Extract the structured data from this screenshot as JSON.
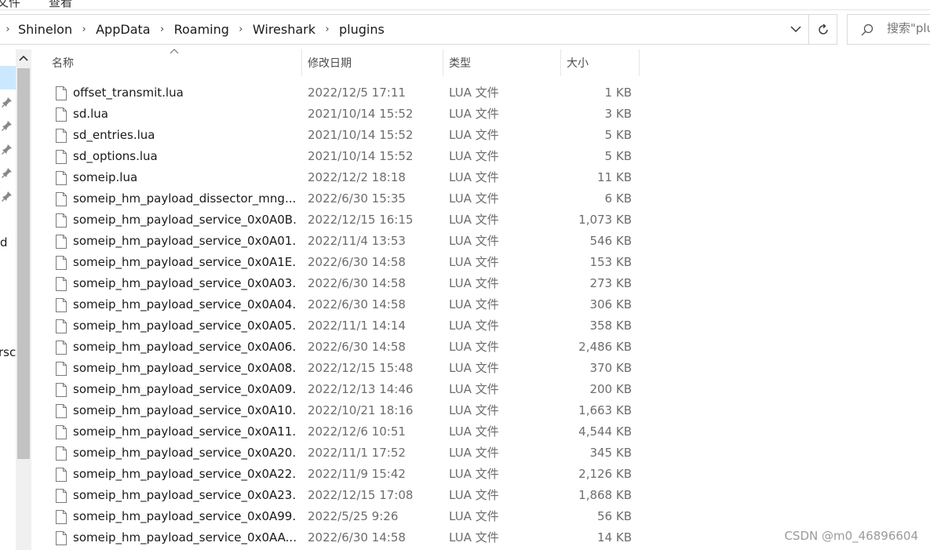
{
  "menu": {
    "items": [
      "文件",
      "查看"
    ]
  },
  "address": {
    "crumbs": [
      "Shinelon",
      "AppData",
      "Roaming",
      "Wireshark",
      "plugins"
    ]
  },
  "search": {
    "placeholder": "搜索\"plu"
  },
  "nav": {
    "texts": [
      "d",
      "rsc"
    ]
  },
  "columns": {
    "name": "名称",
    "date": "修改日期",
    "type": "类型",
    "size": "大小"
  },
  "files": [
    {
      "name": "offset_transmit.lua",
      "date": "2022/12/5 17:11",
      "type": "LUA 文件",
      "size": "1 KB"
    },
    {
      "name": "sd.lua",
      "date": "2021/10/14 15:52",
      "type": "LUA 文件",
      "size": "3 KB"
    },
    {
      "name": "sd_entries.lua",
      "date": "2021/10/14 15:52",
      "type": "LUA 文件",
      "size": "5 KB"
    },
    {
      "name": "sd_options.lua",
      "date": "2021/10/14 15:52",
      "type": "LUA 文件",
      "size": "5 KB"
    },
    {
      "name": "someip.lua",
      "date": "2022/12/2 18:18",
      "type": "LUA 文件",
      "size": "11 KB"
    },
    {
      "name": "someip_hm_payload_dissector_mng....",
      "date": "2022/6/30 15:35",
      "type": "LUA 文件",
      "size": "6 KB"
    },
    {
      "name": "someip_hm_payload_service_0x0A0B...",
      "date": "2022/12/15 16:15",
      "type": "LUA 文件",
      "size": "1,073 KB"
    },
    {
      "name": "someip_hm_payload_service_0x0A01...",
      "date": "2022/11/4 13:53",
      "type": "LUA 文件",
      "size": "546 KB"
    },
    {
      "name": "someip_hm_payload_service_0x0A1E...",
      "date": "2022/6/30 14:58",
      "type": "LUA 文件",
      "size": "153 KB"
    },
    {
      "name": "someip_hm_payload_service_0x0A03...",
      "date": "2022/6/30 14:58",
      "type": "LUA 文件",
      "size": "273 KB"
    },
    {
      "name": "someip_hm_payload_service_0x0A04...",
      "date": "2022/6/30 14:58",
      "type": "LUA 文件",
      "size": "306 KB"
    },
    {
      "name": "someip_hm_payload_service_0x0A05...",
      "date": "2022/11/1 14:14",
      "type": "LUA 文件",
      "size": "358 KB"
    },
    {
      "name": "someip_hm_payload_service_0x0A06...",
      "date": "2022/6/30 14:58",
      "type": "LUA 文件",
      "size": "2,486 KB"
    },
    {
      "name": "someip_hm_payload_service_0x0A08...",
      "date": "2022/12/15 15:48",
      "type": "LUA 文件",
      "size": "370 KB"
    },
    {
      "name": "someip_hm_payload_service_0x0A09...",
      "date": "2022/12/13 14:46",
      "type": "LUA 文件",
      "size": "200 KB"
    },
    {
      "name": "someip_hm_payload_service_0x0A10...",
      "date": "2022/10/21 18:16",
      "type": "LUA 文件",
      "size": "1,663 KB"
    },
    {
      "name": "someip_hm_payload_service_0x0A11...",
      "date": "2022/12/6 10:51",
      "type": "LUA 文件",
      "size": "4,544 KB"
    },
    {
      "name": "someip_hm_payload_service_0x0A20...",
      "date": "2022/11/1 17:52",
      "type": "LUA 文件",
      "size": "345 KB"
    },
    {
      "name": "someip_hm_payload_service_0x0A22...",
      "date": "2022/11/9 15:42",
      "type": "LUA 文件",
      "size": "2,126 KB"
    },
    {
      "name": "someip_hm_payload_service_0x0A23...",
      "date": "2022/12/15 17:08",
      "type": "LUA 文件",
      "size": "1,868 KB"
    },
    {
      "name": "someip_hm_payload_service_0x0A99...",
      "date": "2022/5/25 9:26",
      "type": "LUA 文件",
      "size": "56 KB"
    },
    {
      "name": "someip_hm_payload_service_0x0AA...",
      "date": "2022/6/30 14:58",
      "type": "LUA 文件",
      "size": "14 KB"
    }
  ],
  "watermark": "CSDN @m0_46896604"
}
